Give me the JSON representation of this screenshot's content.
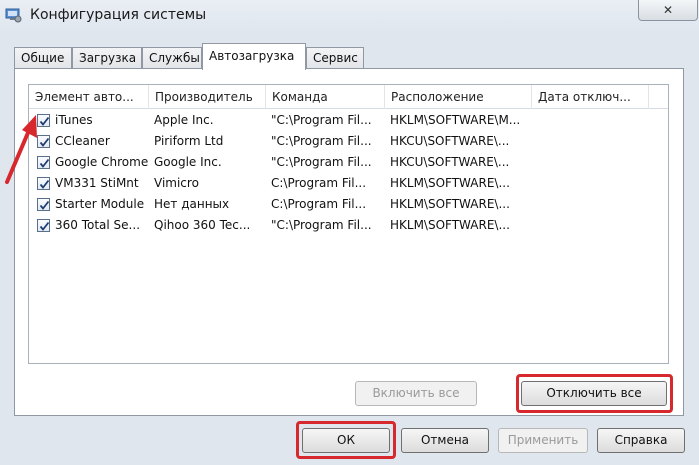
{
  "window": {
    "title": "Конфигурация системы",
    "close_label": "✕"
  },
  "tabs": [
    {
      "label": "Общие"
    },
    {
      "label": "Загрузка"
    },
    {
      "label": "Службы"
    },
    {
      "label": "Автозагрузка"
    },
    {
      "label": "Сервис"
    }
  ],
  "startup": {
    "columns": [
      "Элемент авто...",
      "Производитель",
      "Команда",
      "Расположение",
      "Дата отключ..."
    ],
    "rows": [
      {
        "checked": true,
        "name": "iTunes",
        "vendor": "Apple Inc.",
        "command": "\"C:\\Program Fil...",
        "location": "HKLM\\SOFTWARE\\M..."
      },
      {
        "checked": true,
        "name": "CCleaner",
        "vendor": "Piriform Ltd",
        "command": "\"C:\\Program Fil...",
        "location": "HKCU\\SOFTWARE\\..."
      },
      {
        "checked": true,
        "name": "Google Chrome",
        "vendor": "Google Inc.",
        "command": "\"C:\\Program Fil...",
        "location": "HKCU\\SOFTWARE\\..."
      },
      {
        "checked": true,
        "name": "VM331 StiMnt",
        "vendor": "Vimicro",
        "command": "C:\\Program Fil...",
        "location": "HKLM\\SOFTWARE\\..."
      },
      {
        "checked": true,
        "name": "Starter Module",
        "vendor": "Нет данных",
        "command": "C:\\Program Fil...",
        "location": "HKLM\\SOFTWARE\\..."
      },
      {
        "checked": true,
        "name": "360 Total Se...",
        "vendor": "Qihoo 360 Tec...",
        "command": "\"C:\\Program Fil...",
        "location": "HKLM\\SOFTWARE\\..."
      }
    ]
  },
  "buttons": {
    "enable_all": "Включить все",
    "disable_all": "Отключить все",
    "ok": "ОК",
    "cancel": "Отмена",
    "apply": "Применить",
    "help": "Справка"
  },
  "colors": {
    "highlight": "#d6282d",
    "panel": "#ffffff",
    "background": "#dfe6ee"
  }
}
